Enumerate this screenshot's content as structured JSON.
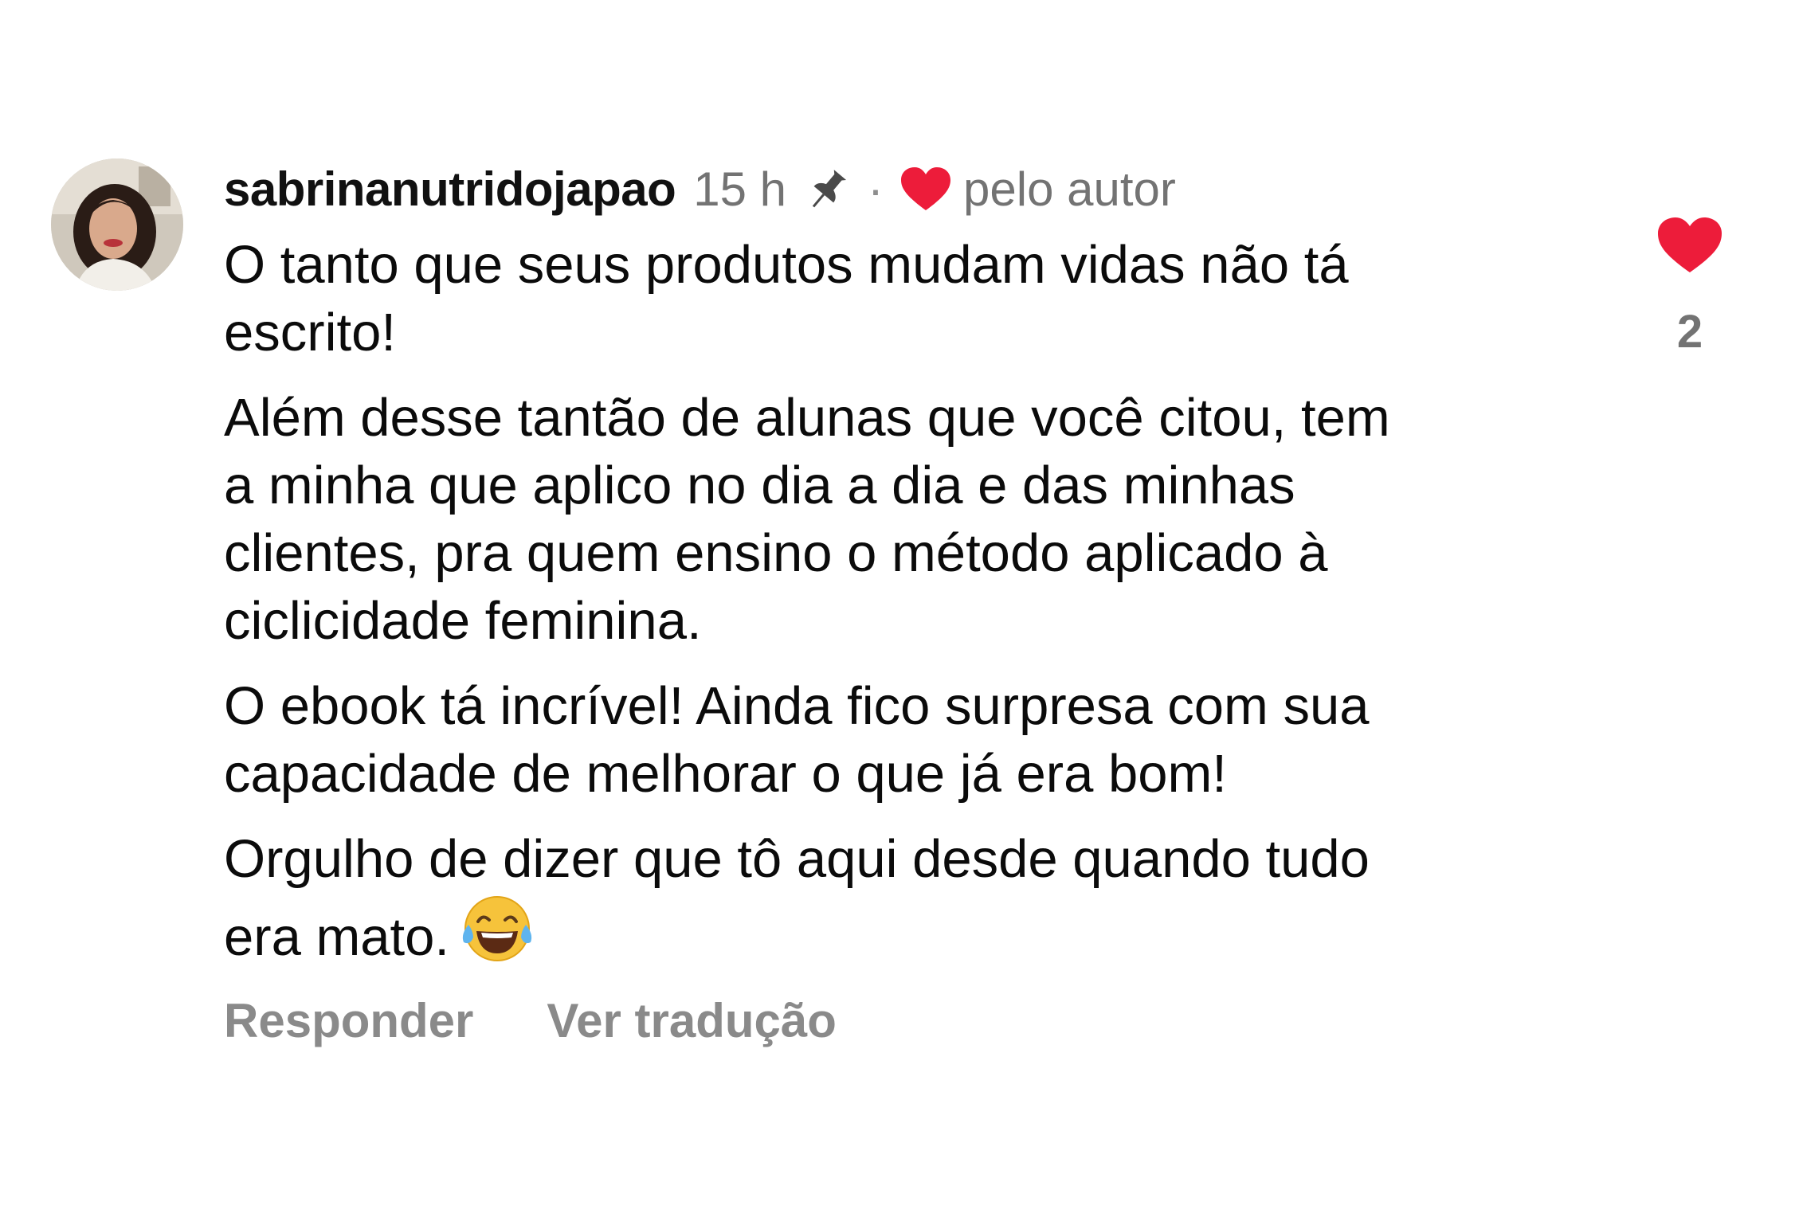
{
  "comment": {
    "username": "sabrinanutridojapao",
    "time": "15 h",
    "separator": "·",
    "liked_by_author_label": "pelo autor",
    "paragraphs": [
      "O tanto que seus produtos mudam vidas não tá\nescrito!",
      "Além desse tantão de alunas que você citou, tem\na minha que aplico no dia a dia e das minhas\nclientes, pra quem ensino o método aplicado à\nciclicidade feminina.",
      "O ebook tá incrível! Ainda fico surpresa com sua\ncapacidade de melhorar o que já era bom!",
      "Orgulho de dizer que tô aqui desde quando tudo\nera mato."
    ],
    "emoji_icon": "face-with-tears-of-joy-icon",
    "likes": "2",
    "actions": {
      "reply_label": "Responder",
      "translate_label": "Ver tradução"
    }
  },
  "colors": {
    "heart": "#ed1c3a",
    "meta_gray": "#737373",
    "action_gray": "#8a8a8a",
    "text": "#0b0b0b"
  }
}
